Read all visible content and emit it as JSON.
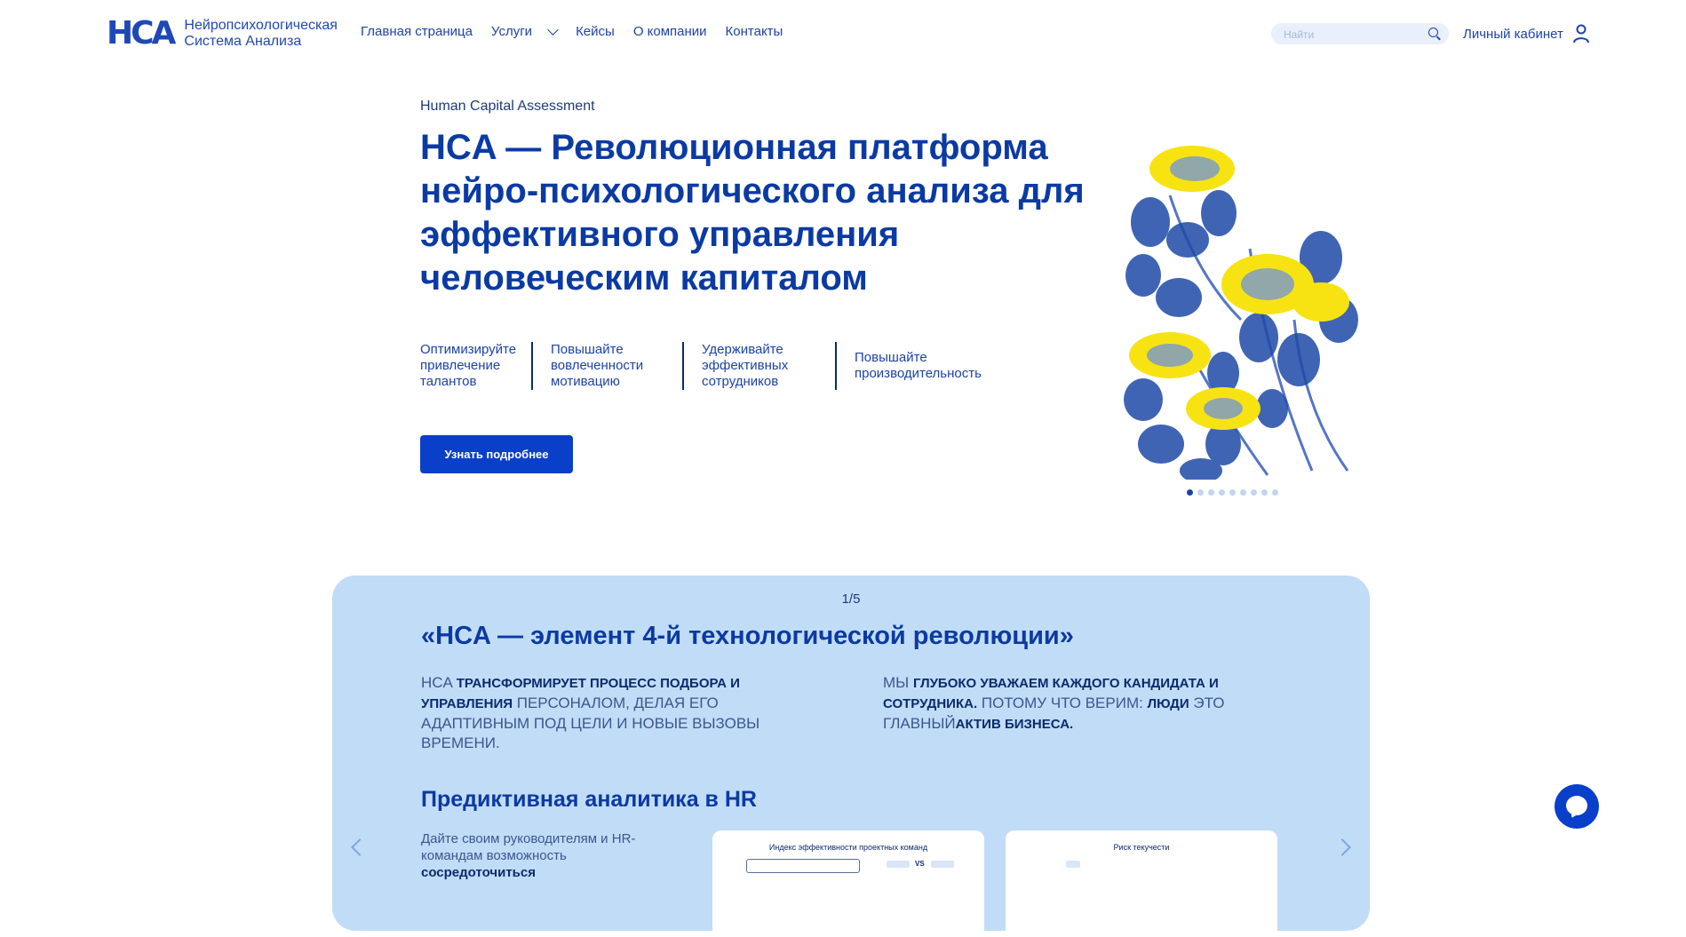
{
  "header": {
    "logo_mark": "HCA",
    "logo_line1": "Нейропсихологическая",
    "logo_line2": "Система Анализа",
    "nav": {
      "home": "Главная страница",
      "services": "Услуги",
      "cases": "Кейсы",
      "about": "О компании",
      "contacts": "Контакты"
    },
    "search_placeholder": "Найти",
    "account": "Личный кабинет"
  },
  "hero": {
    "subtitle": "Human Capital Assessment",
    "title": "HCA — Революционная платформа нейро-психологического анализа для эффективного управления человеческим капиталом",
    "benefits": [
      {
        "line1": "Оптимизируйте",
        "line2": "привлечение",
        "line3": "талантов"
      },
      {
        "line1": "Повышайте",
        "line2": "вовлеченности",
        "line3": "мотивацию"
      },
      {
        "line1": "Удерживайте",
        "line2": "эффективных",
        "line3": "сотрудников"
      },
      {
        "line1": "Повышайте",
        "line2": "производительность"
      }
    ],
    "cta": "Узнать подробнее",
    "slider_total": 9,
    "slider_active": 1
  },
  "panel": {
    "counter": "1/5",
    "quote": "«HCA — элемент 4-й технологической революции»",
    "para1": {
      "p1": "HCA ",
      "b1": "трансформирует процесс подбора и управления",
      "p2": " персоналом, делая его адаптивным под цели и новые вызовы времени."
    },
    "para2": {
      "p1": "Мы ",
      "b1": "глубоко уважаем каждого кандидата и сотрудника.",
      "p2": " Потому что верим: ",
      "b2": "люди",
      "p3": " это главный",
      "b3": "актив бизнеса."
    },
    "subhead": "Предиктивная аналитика в HR",
    "desc_plain": "Дайте своим руководителям и HR-командам возможность ",
    "desc_bold": "сосредоточиться",
    "card1_title": "Индекс эффективности проектных команд",
    "card1_vs": "VS",
    "card2_title": "Риск текучести"
  },
  "colors": {
    "brand": "#0b3aa3",
    "button": "#0a3fc9",
    "panel_bg": "#c1dcf6",
    "search_bg": "#e9f0fb"
  },
  "icons": [
    "search-icon",
    "user-icon",
    "chevron-down-icon",
    "chat-icon",
    "arrow-left-icon",
    "arrow-right-icon"
  ]
}
